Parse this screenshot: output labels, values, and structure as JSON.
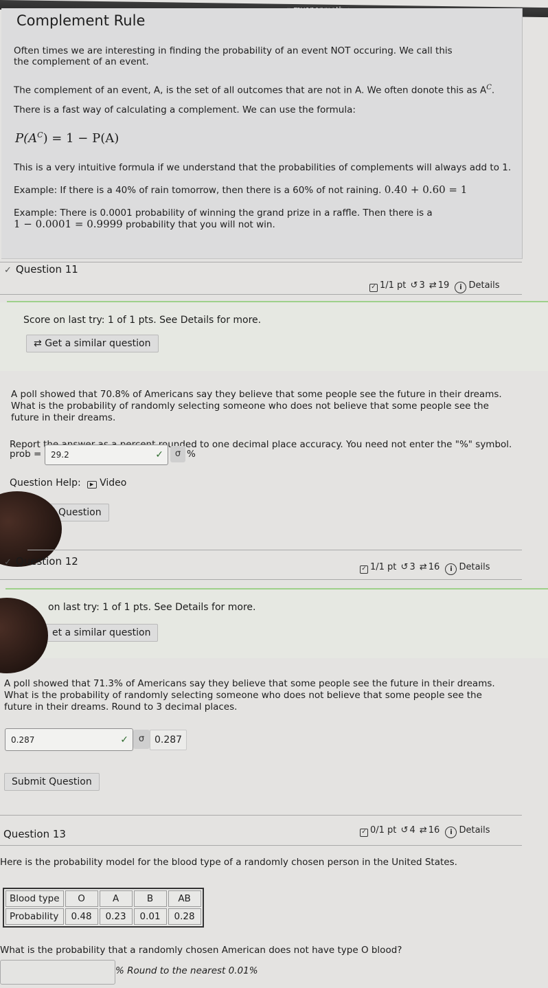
{
  "browser": {
    "url": "myopenmath.com"
  },
  "info_box": {
    "title": "Complement Rule",
    "paragraphs": [
      "Often times we are interesting in finding the probability of an event NOT occuring. We call this the complement of an event.",
      "The complement of an event, A, is the set of all outcomes that are not in A. We often donote this as A",
      "There is a fast way of calculating a complement. We can use the formula:",
      "This is a very intuitive formula if we understand that the probabilities of complements will always add to 1.",
      "Example: If there is a 40% of rain tomorrow, then there is a 60% of not raining.",
      "Example: There is 0.0001 probability of winning the grand prize in a raffle. Then there is a",
      "probability that you will not win."
    ],
    "complement_superscript": "C",
    "formula": {
      "lhs": "P(A",
      "sup": "C",
      "rhs": ") = 1 − P(A)"
    },
    "example1_math": "0.40 + 0.60 = 1",
    "example2_math": "1 − 0.0001 = 0.9999"
  },
  "questions": [
    {
      "title": "Question 11",
      "status_icon": "check-icon",
      "score": "1/1 pt",
      "attempts": "3",
      "versions": "19",
      "details_label": "Details",
      "score_text": "Score on last try: 1 of 1 pts. See Details for more.",
      "similar_button": "Get a similar question",
      "body": "A poll showed that 70.8% of Americans say they believe that some people see the future in their dreams. What is the probability of randomly selecting someone who does not believe that some people see the future in their dreams.",
      "instruction": "Report the answer as a percent rounded to one decimal place accuracy. You need not enter the \"%\" symbol.",
      "answer_label": "prob =",
      "answer_value": "29.2",
      "answer_unit": "%",
      "help_label": "Question Help:",
      "help_video": "Video",
      "submit_button": "Question"
    },
    {
      "title": "Question 12",
      "status_icon": "check-icon",
      "score": "1/1 pt",
      "attempts": "3",
      "versions": "16",
      "details_label": "Details",
      "score_text": "on last try: 1 of 1 pts. See Details for more.",
      "similar_button": "et a similar question",
      "body": "A poll showed that 71.3% of Americans say they believe that some people see the future in their dreams. What is the probability of randomly selecting someone who does not believe that some people see the future in their dreams. Round to 3 decimal places.",
      "answer_value": "0.287",
      "answer_preview": "0.287",
      "submit_button": "Submit Question"
    },
    {
      "title": "Question 13",
      "score": "0/1 pt",
      "attempts": "4",
      "versions": "16",
      "details_label": "Details",
      "intro": "Here is the probability model for the blood type of a randomly chosen person in the United States.",
      "table": {
        "row_headers": [
          "Blood type",
          "Probability"
        ],
        "columns": [
          "O",
          "A",
          "B",
          "AB"
        ],
        "values": [
          "0.48",
          "0.23",
          "0.01",
          "0.28"
        ]
      },
      "question": "What is the probability that a randomly chosen American does not have type O blood?",
      "answer_value": "",
      "answer_suffix": "% Round to the nearest 0.01%"
    }
  ]
}
